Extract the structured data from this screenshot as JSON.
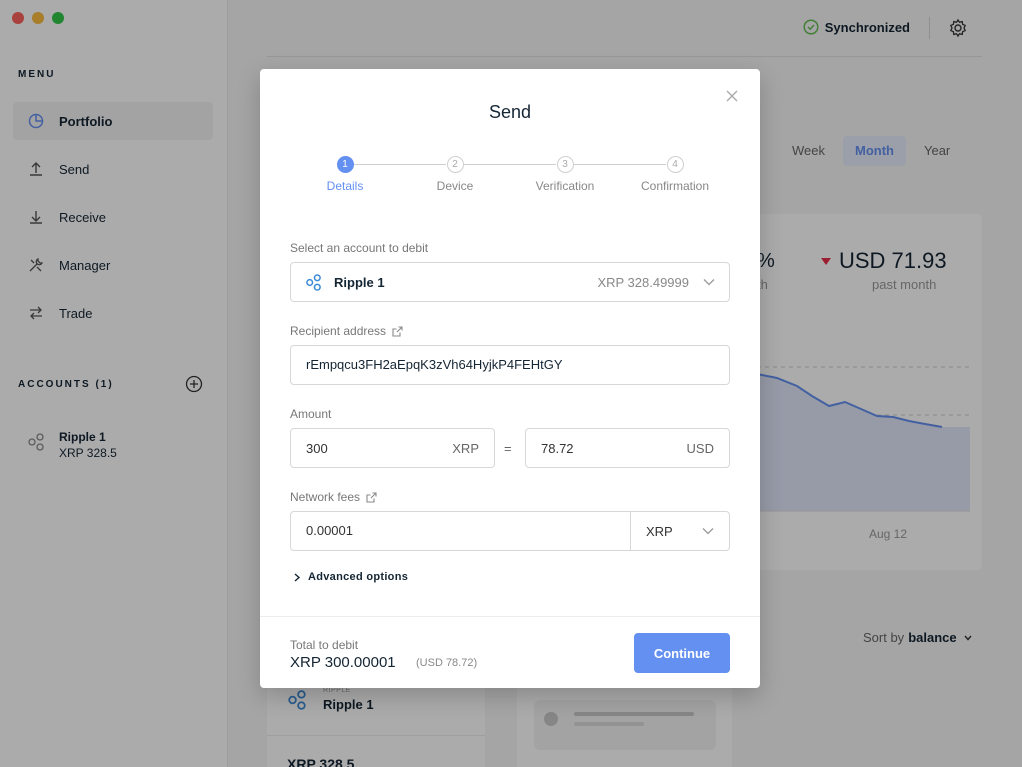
{
  "sidebar": {
    "menu_title": "MENU",
    "items": [
      {
        "label": "Portfolio",
        "icon": "pie-chart-icon"
      },
      {
        "label": "Send",
        "icon": "arrow-up-icon"
      },
      {
        "label": "Receive",
        "icon": "arrow-down-icon"
      },
      {
        "label": "Manager",
        "icon": "tools-icon"
      },
      {
        "label": "Trade",
        "icon": "swap-icon"
      }
    ],
    "accounts_title": "ACCOUNTS (1)",
    "account": {
      "name": "Ripple 1",
      "balance": "XRP 328.5"
    }
  },
  "topbar": {
    "sync_status": "Synchronized"
  },
  "periods": [
    "Week",
    "Month",
    "Year"
  ],
  "stats": {
    "pct": "%",
    "pct_label": "th",
    "usd": "USD 71.93",
    "usd_label": "past month"
  },
  "chart_data": {
    "type": "area",
    "x_label_visible": "Aug 12",
    "color": "#6490f1"
  },
  "sort": {
    "label": "Sort by",
    "value": "balance"
  },
  "asset_card": {
    "tag": "RIPPLE",
    "name": "Ripple 1",
    "balance": "XRP 328.5"
  },
  "modal": {
    "title": "Send",
    "steps": [
      {
        "num": "1",
        "label": "Details"
      },
      {
        "num": "2",
        "label": "Device"
      },
      {
        "num": "3",
        "label": "Verification"
      },
      {
        "num": "4",
        "label": "Confirmation"
      }
    ],
    "account_label": "Select an account to debit",
    "account_name": "Ripple 1",
    "account_balance": "XRP 328.49999",
    "recipient_label": "Recipient address",
    "recipient_value": "rEmpqcu3FH2aEpqK3zVh64HyjkP4FEHtGY",
    "amount_label": "Amount",
    "amount_value": "300",
    "amount_unit": "XRP",
    "equals": "=",
    "fiat_value": "78.72",
    "fiat_unit": "USD",
    "fees_label": "Network fees",
    "fees_value": "0.00001",
    "fees_unit": "XRP",
    "advanced": "Advanced options",
    "total_label": "Total to debit",
    "total_value": "XRP 300.00001",
    "total_fiat": "(USD 78.72)",
    "continue_label": "Continue"
  },
  "colors": {
    "accent": "#6490f1",
    "negative": "#ea2e49",
    "success": "#66be54"
  }
}
